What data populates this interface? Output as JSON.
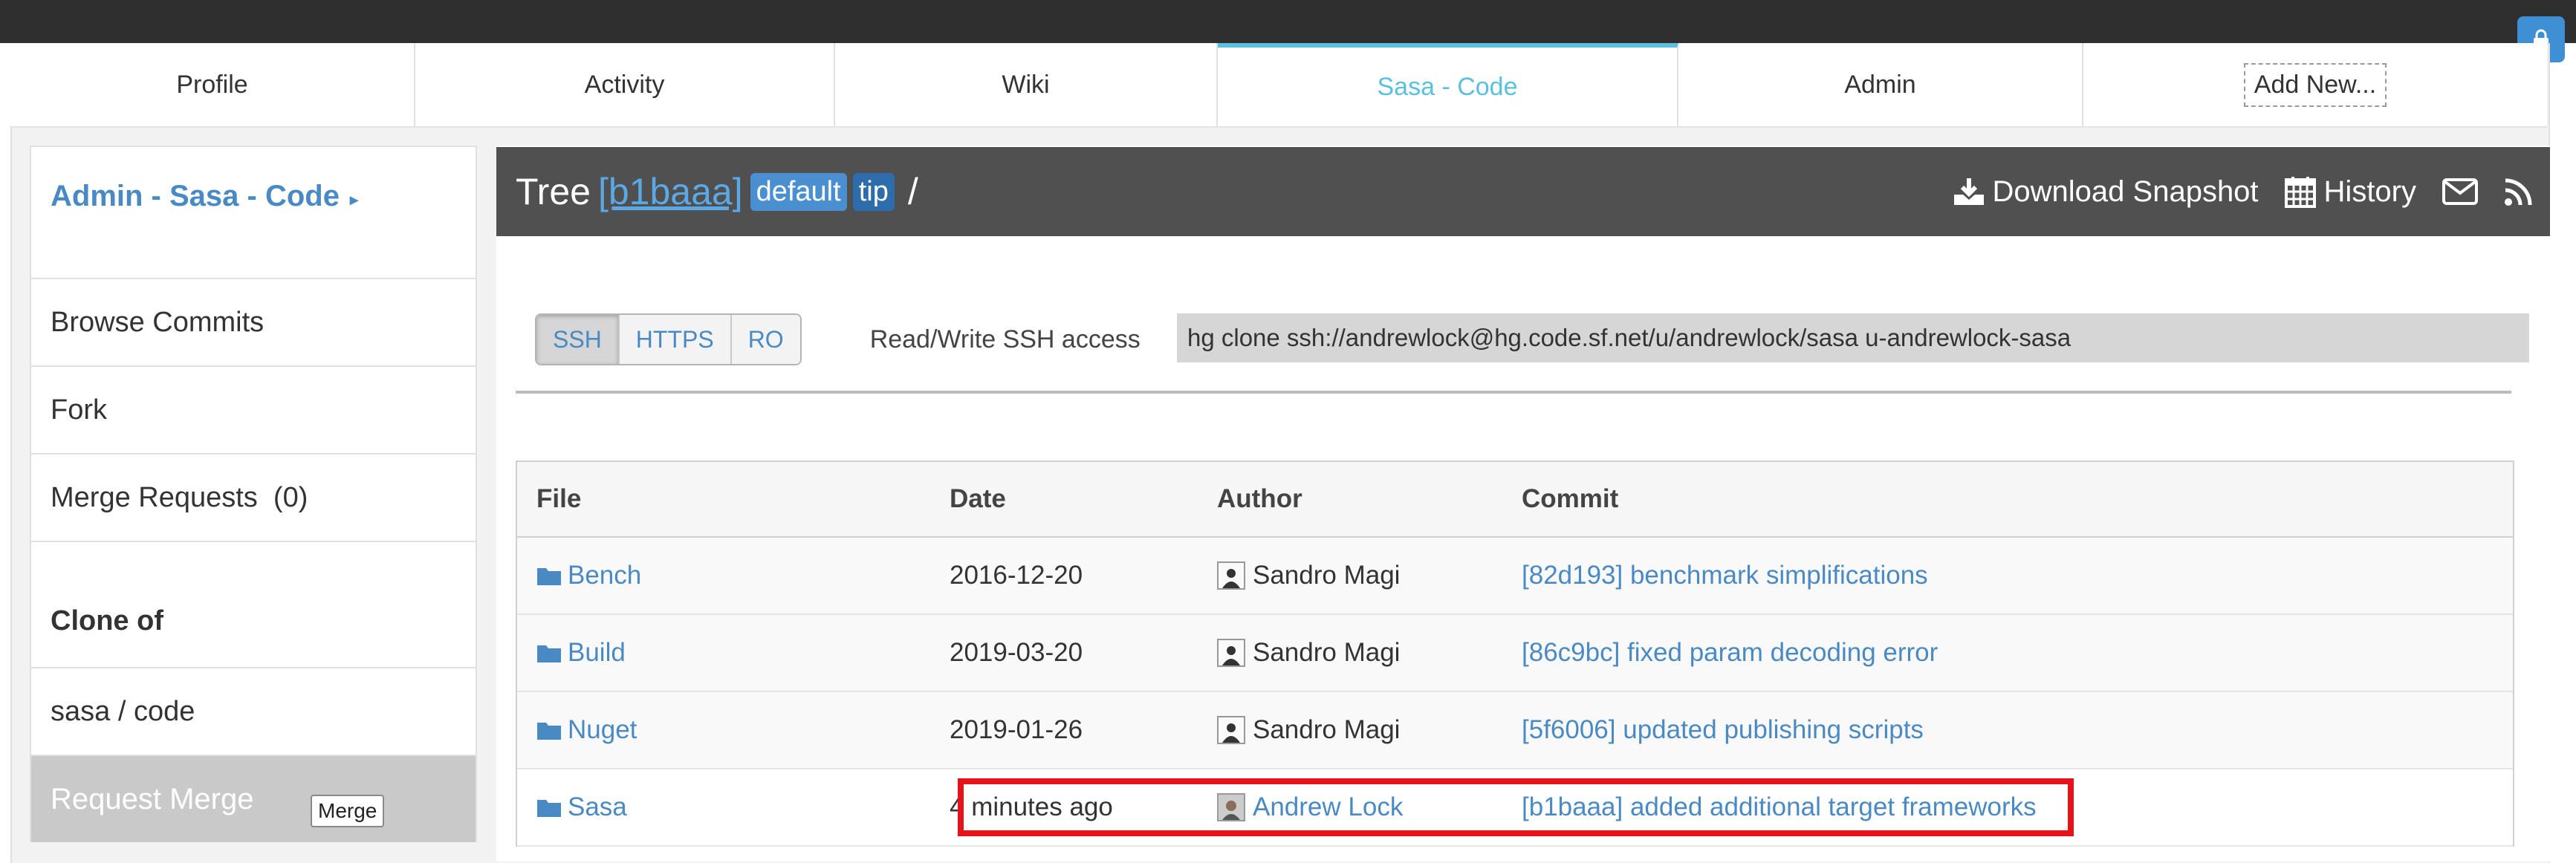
{
  "tabs": [
    {
      "label": "Profile"
    },
    {
      "label": "Activity"
    },
    {
      "label": "Wiki"
    },
    {
      "label": "Sasa - Code",
      "active": true
    },
    {
      "label": "Admin"
    },
    {
      "label": "Add New..."
    }
  ],
  "sidebar": {
    "header": "Admin - Sasa - Code",
    "items": [
      {
        "label": "Browse Commits"
      },
      {
        "label": "Fork"
      },
      {
        "label": "Merge Requests  (0)"
      }
    ],
    "clone_of_heading": "Clone of",
    "clone_source": "sasa / code",
    "request_merge": "Request Merge",
    "merge_tooltip": "Merge"
  },
  "tree": {
    "title": "Tree",
    "hash": "[b1baaa]",
    "badge_default": "default",
    "badge_tip": "tip",
    "slash": "/",
    "download": "Download Snapshot",
    "history": "History",
    "icons": [
      "download-icon",
      "calendar-icon",
      "envelope-icon",
      "rss-icon"
    ]
  },
  "clone": {
    "protocols": [
      "SSH",
      "HTTPS",
      "RO"
    ],
    "active_protocol": "SSH",
    "access_label": "Read/Write SSH access",
    "url": "hg clone ssh://andrewlock@hg.code.sf.net/u/andrewlock/sasa u-andrewlock-sasa"
  },
  "table": {
    "headers": {
      "file": "File",
      "date": "Date",
      "author": "Author",
      "commit": "Commit"
    },
    "rows": [
      {
        "file": "Bench",
        "date": "2016-12-20",
        "author": "Sandro Magi",
        "commit": "[82d193] benchmark simplifications"
      },
      {
        "file": "Build",
        "date": "2019-03-20",
        "author": "Sandro Magi",
        "commit": "[86c9bc] fixed param decoding error"
      },
      {
        "file": "Nuget",
        "date": "2019-01-26",
        "author": "Sandro Magi",
        "commit": "[5f6006] updated publishing scripts"
      },
      {
        "file": "Sasa",
        "date": "4 minutes ago",
        "author": "Andrew Lock",
        "commit": "[b1baaa] added additional target frameworks"
      }
    ]
  },
  "colors": {
    "accent": "#5bc0de",
    "link": "#4a8ac4",
    "highlight": "#e8131a",
    "header_bar": "#505050"
  }
}
